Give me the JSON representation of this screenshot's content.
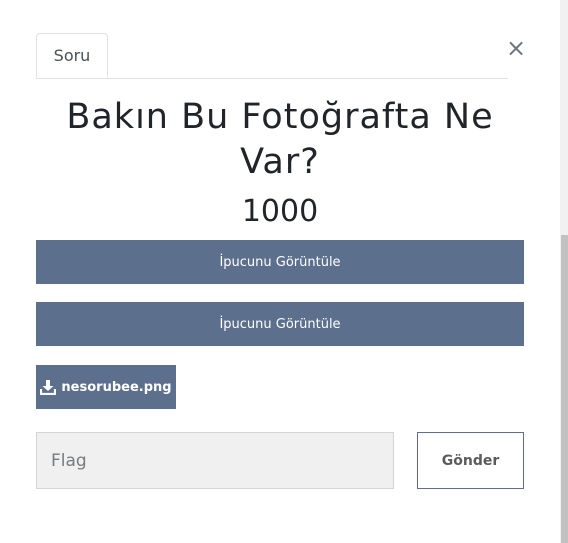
{
  "modal": {
    "tab_label": "Soru",
    "close_glyph": "×",
    "title": "Bakın Bu Fotoğrafta Ne Var?",
    "points": "1000",
    "hints": [
      {
        "label": "İpucunu Görüntüle"
      },
      {
        "label": "İpucunu Görüntüle"
      }
    ],
    "file": {
      "name": "nesorubee.png",
      "icon": "download-icon"
    },
    "flag_input": {
      "placeholder": "Flag",
      "value": ""
    },
    "submit_label": "Gönder"
  },
  "colors": {
    "button_bg": "#5c6f8d",
    "button_text": "#ffffff",
    "input_bg": "#f0f0f0",
    "scrollbar_thumb": "#c1c1c1"
  }
}
